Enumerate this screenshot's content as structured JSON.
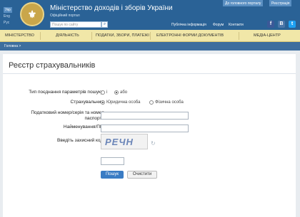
{
  "languages": [
    "Укр",
    "Eng",
    "Рус"
  ],
  "header": {
    "title": "Міністерство доходів і зборів України",
    "subtitle": "Офіційний портал",
    "search_placeholder": "Пошук по сайту",
    "main_portal_link": "До головного порталу",
    "register_link": "Реєстрація",
    "utility_links": [
      "Публічна інформація",
      "Форум",
      "Контакти"
    ],
    "social": [
      "f",
      "B",
      "t"
    ]
  },
  "nav": {
    "items": [
      "МІНІСТЕРСТВО",
      "ДІЯЛЬНІСТЬ",
      "ПОДАТКИ, ЗБОРИ, ПЛАТЕЖІ",
      "ЕЛЕКТРОННІ ФОРМИ ДОКУМЕНТІВ",
      "МЕДІА-ЦЕНТР"
    ]
  },
  "breadcrumb": "Головна >",
  "form": {
    "title": "Реєстр страхувальників",
    "search_type_label": "Тип поєднання параметрів пошуку:",
    "search_type_options": [
      "і",
      "або"
    ],
    "insurer_label": "Страхувальник:",
    "insurer_options": [
      "Юридична особа",
      "Фізична особа"
    ],
    "tax_number_label": "Податковий номер/серія та номер паспорта",
    "name_label": "Найменування/ПІБ",
    "captcha_label": "Введіть захисний код:",
    "captcha_text": "РЕЧН",
    "search_button": "Пошук",
    "clear_button": "Очистити"
  },
  "colors": {
    "header": "#2a6296",
    "nav": "#f1e7a8",
    "breadcrumb_bar": "#3d6e9e",
    "primary_button": "#3a7cc4"
  }
}
